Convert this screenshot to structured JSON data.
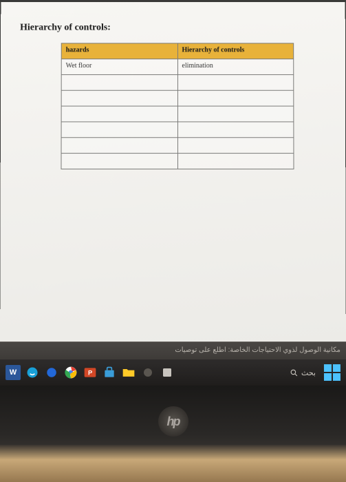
{
  "document": {
    "title": "Hierarchy of controls:",
    "table": {
      "headers": [
        "hazards",
        "Hierarchy of controls"
      ],
      "rows": [
        [
          "Wet floor",
          "elimination"
        ],
        [
          "",
          ""
        ],
        [
          "",
          ""
        ],
        [
          "",
          ""
        ],
        [
          "",
          ""
        ],
        [
          "",
          ""
        ],
        [
          "",
          ""
        ]
      ]
    }
  },
  "accessibility_bar": {
    "text": "مكانية الوصول لذوي الاحتياجات الخاصة: اطلع على توصيات"
  },
  "taskbar": {
    "word_label": "W",
    "search_label": "بحث",
    "hp_label": "hp"
  }
}
